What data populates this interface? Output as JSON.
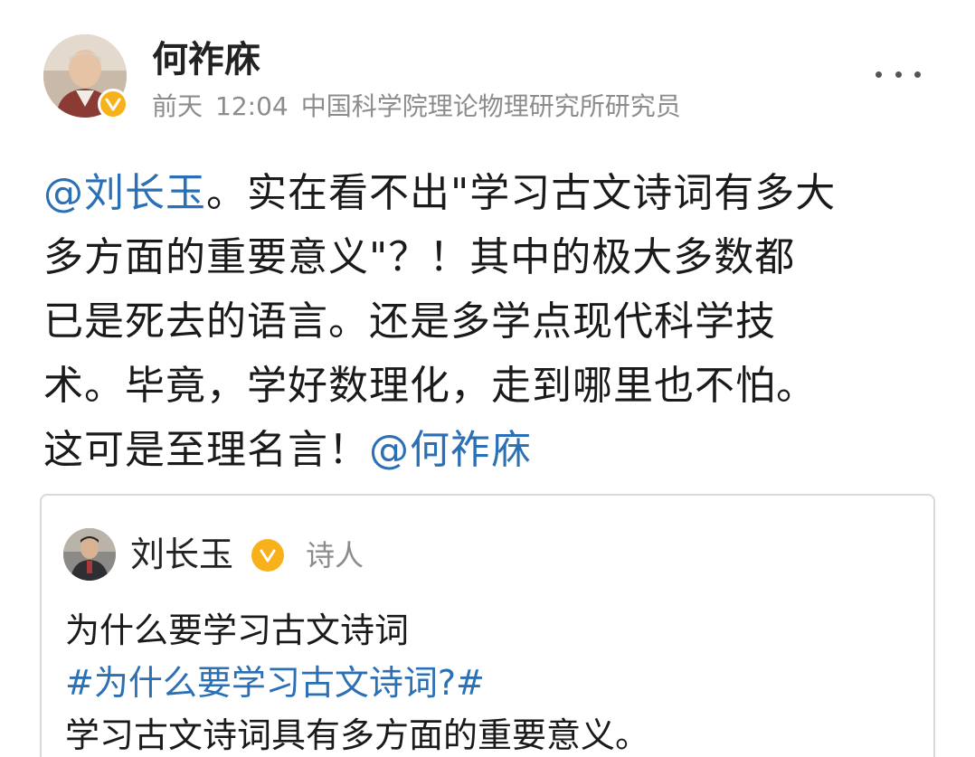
{
  "post": {
    "author": {
      "name": "何祚庥",
      "time_day": "前天",
      "time_clock": "12:04",
      "title": "中国科学院理论物理研究所研究员",
      "verified": true
    },
    "text": {
      "line1_mention": "@刘长玉",
      "line1_rest": "。实在看不出\"学习古文诗词有多大",
      "line2": "多方面的重要意义\"？！其中的极大多数都",
      "line3": "已是死去的语言。还是多学点现代科学技",
      "line4": "术。毕竟，学好数理化，走到哪里也不怕。",
      "line5_text": "这可是至理名言！",
      "line5_mention": "@何祚庥"
    },
    "more_icon": "more-horizontal-icon"
  },
  "quote": {
    "author": {
      "name": "刘长玉",
      "role": "诗人",
      "verified": true
    },
    "text": {
      "line1": "为什么要学习古文诗词",
      "hashtag": "#为什么要学习古文诗词?#",
      "line3": "学习古文诗词具有多方面的重要意义。"
    }
  },
  "colors": {
    "link": "#2b6fb5",
    "badge": "#f7b21b",
    "meta_text": "#8c8c8c"
  }
}
